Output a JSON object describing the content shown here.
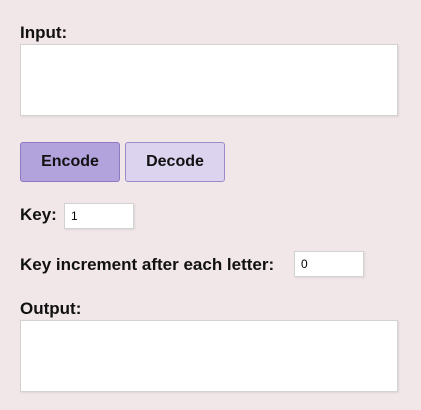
{
  "input": {
    "label": "Input:",
    "value": ""
  },
  "buttons": {
    "encode": "Encode",
    "decode": "Decode"
  },
  "key": {
    "label": "Key:",
    "value": "1"
  },
  "increment": {
    "label": "Key increment after each letter:",
    "value": "0"
  },
  "output": {
    "label": "Output:",
    "value": ""
  },
  "colors": {
    "background": "#f1e7e8",
    "encode_button": "#b3a3dc",
    "decode_button": "#dcd3ee"
  }
}
